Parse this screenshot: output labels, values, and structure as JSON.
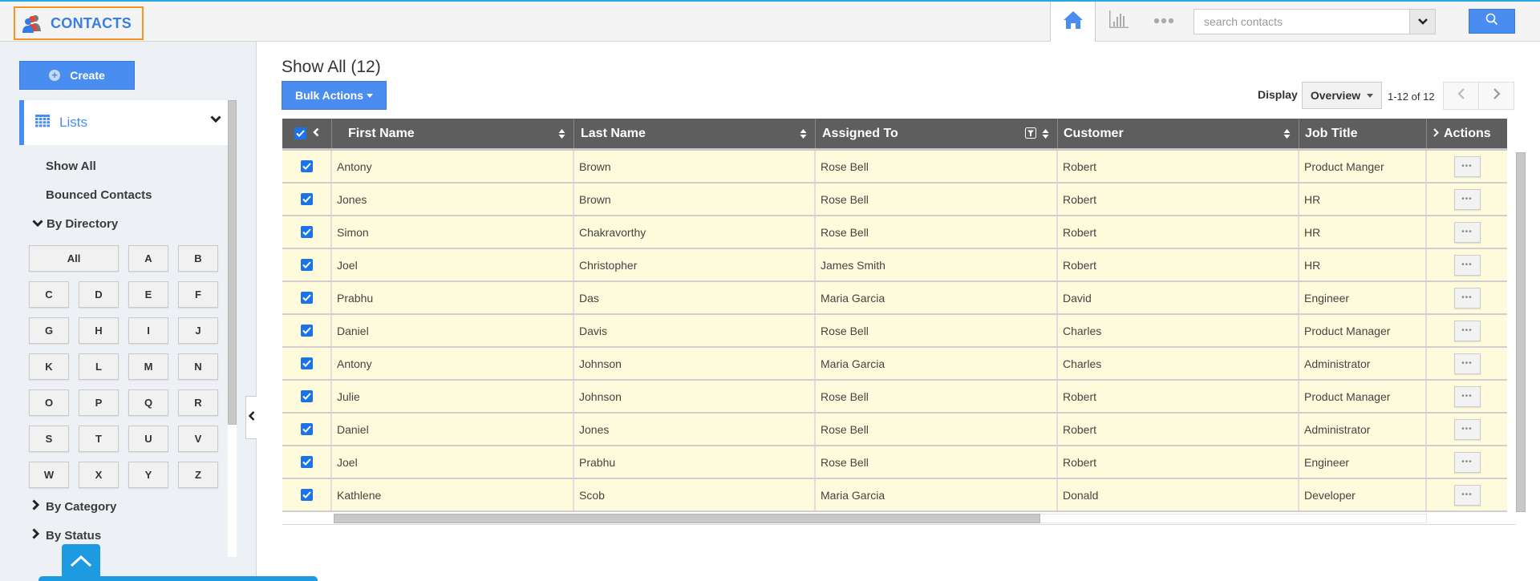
{
  "header": {
    "app_title": "CONTACTS",
    "search_placeholder": "search contacts",
    "nav_icons": [
      "home-icon",
      "bar-chart-icon",
      "more-dots-icon"
    ],
    "accent_color": "#4a8df0"
  },
  "sidebar": {
    "create_label": "Create",
    "lists_label": "Lists",
    "links": [
      "Show All",
      "Bounced Contacts"
    ],
    "directory_label": "By Directory",
    "letters": [
      "All",
      "A",
      "B",
      "C",
      "D",
      "E",
      "F",
      "G",
      "H",
      "I",
      "J",
      "K",
      "L",
      "M",
      "N",
      "O",
      "P",
      "Q",
      "R",
      "S",
      "T",
      "U",
      "V",
      "W",
      "X",
      "Y",
      "Z"
    ],
    "category_label": "By Category",
    "status_label": "By Status"
  },
  "main": {
    "title": "Show All (12)",
    "bulk_actions_label": "Bulk Actions",
    "display_label": "Display",
    "display_value": "Overview",
    "pager_text": "1-12 of 12"
  },
  "table": {
    "columns": [
      "First Name",
      "Last Name",
      "Assigned To",
      "Customer",
      "Job Title",
      "Actions"
    ],
    "actions_label": "•••",
    "rows": [
      {
        "first": "Antony",
        "last": "Brown",
        "assigned": "Rose Bell",
        "customer": "Robert",
        "job": "Product Manger",
        "checked": true
      },
      {
        "first": "Jones",
        "last": "Brown",
        "assigned": "Rose Bell",
        "customer": "Robert",
        "job": "HR",
        "checked": true
      },
      {
        "first": "Simon",
        "last": "Chakravorthy",
        "assigned": "Rose Bell",
        "customer": "Robert",
        "job": "HR",
        "checked": true
      },
      {
        "first": "Joel",
        "last": "Christopher",
        "assigned": "James Smith",
        "customer": "Robert",
        "job": "HR",
        "checked": true
      },
      {
        "first": "Prabhu",
        "last": "Das",
        "assigned": "Maria Garcia",
        "customer": "David",
        "job": "Engineer",
        "checked": true
      },
      {
        "first": "Daniel",
        "last": "Davis",
        "assigned": "Rose Bell",
        "customer": "Charles",
        "job": "Product Manager",
        "checked": true
      },
      {
        "first": "Antony",
        "last": "Johnson",
        "assigned": "Maria Garcia",
        "customer": "Charles",
        "job": "Administrator",
        "checked": true
      },
      {
        "first": "Julie",
        "last": "Johnson",
        "assigned": "Rose Bell",
        "customer": "Robert",
        "job": "Product Manager",
        "checked": true
      },
      {
        "first": "Daniel",
        "last": "Jones",
        "assigned": "Rose Bell",
        "customer": "Robert",
        "job": "Administrator",
        "checked": true
      },
      {
        "first": "Joel",
        "last": "Prabhu",
        "assigned": "Rose Bell",
        "customer": "Robert",
        "job": "Engineer",
        "checked": true
      },
      {
        "first": "Kathlene",
        "last": "Scob",
        "assigned": "Maria Garcia",
        "customer": "Donald",
        "job": "Developer",
        "checked": true
      }
    ]
  }
}
